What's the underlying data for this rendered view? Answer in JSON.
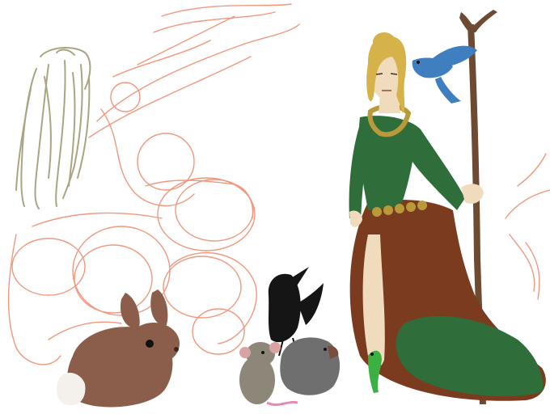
{
  "scene": {
    "background": "#ffffff",
    "colors": {
      "sketch_orange": "#f0987e",
      "sketch_olive": "#a8a682",
      "hair_blonde": "#d6b24a",
      "gown_green": "#2f6e3a",
      "gown_brown": "#7a3b1e",
      "sash_gold": "#b99a3a",
      "staff_brown": "#6e4a32",
      "bird_blue": "#3f7fbf",
      "rabbit_brown": "#8a5e4b",
      "crow_black": "#151515",
      "mouse_grey": "#8c8778",
      "hedgehog_grey": "#6f6f6f",
      "frog_green": "#3cb043",
      "skin": "#f0dcbc"
    },
    "elements": [
      "orange-sketch-lines",
      "olive-sketch-figure",
      "sorceress",
      "staff",
      "bluebird",
      "rabbit",
      "crow",
      "mouse",
      "hedgehog",
      "frog"
    ]
  }
}
